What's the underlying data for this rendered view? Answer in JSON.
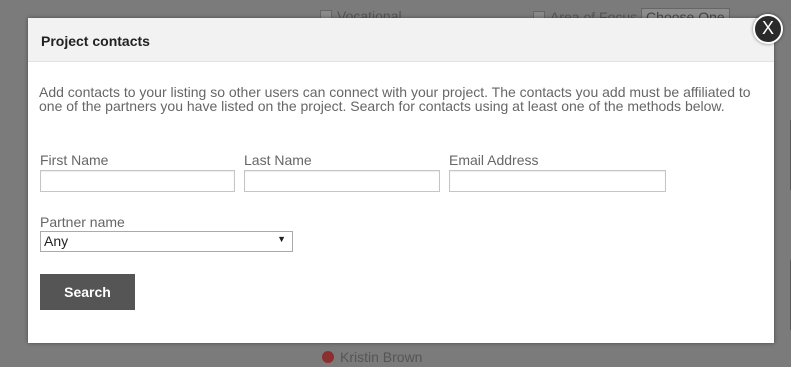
{
  "background": {
    "vocational_label": "Vocational",
    "area_of_focus_label": "Area of Focus",
    "area_of_focus_value": "Choose One",
    "contact_name": "Kristin Brown"
  },
  "modal": {
    "title": "Project contacts",
    "close_label": "X",
    "intro_text": "Add contacts to your listing so other users can connect with your project. The contacts you add must be affiliated to one of the partners you have listed on the project. Search for contacts using at least one of the methods below.",
    "first_name_label": "First Name",
    "first_name_value": "",
    "last_name_label": "Last Name",
    "last_name_value": "",
    "email_label": "Email Address",
    "email_value": "",
    "partner_label": "Partner name",
    "partner_selected": "Any",
    "search_label": "Search"
  },
  "colors": {
    "overlay": "#7b7b7b",
    "modal_header": "#f2f2f2",
    "button": "#555555"
  }
}
